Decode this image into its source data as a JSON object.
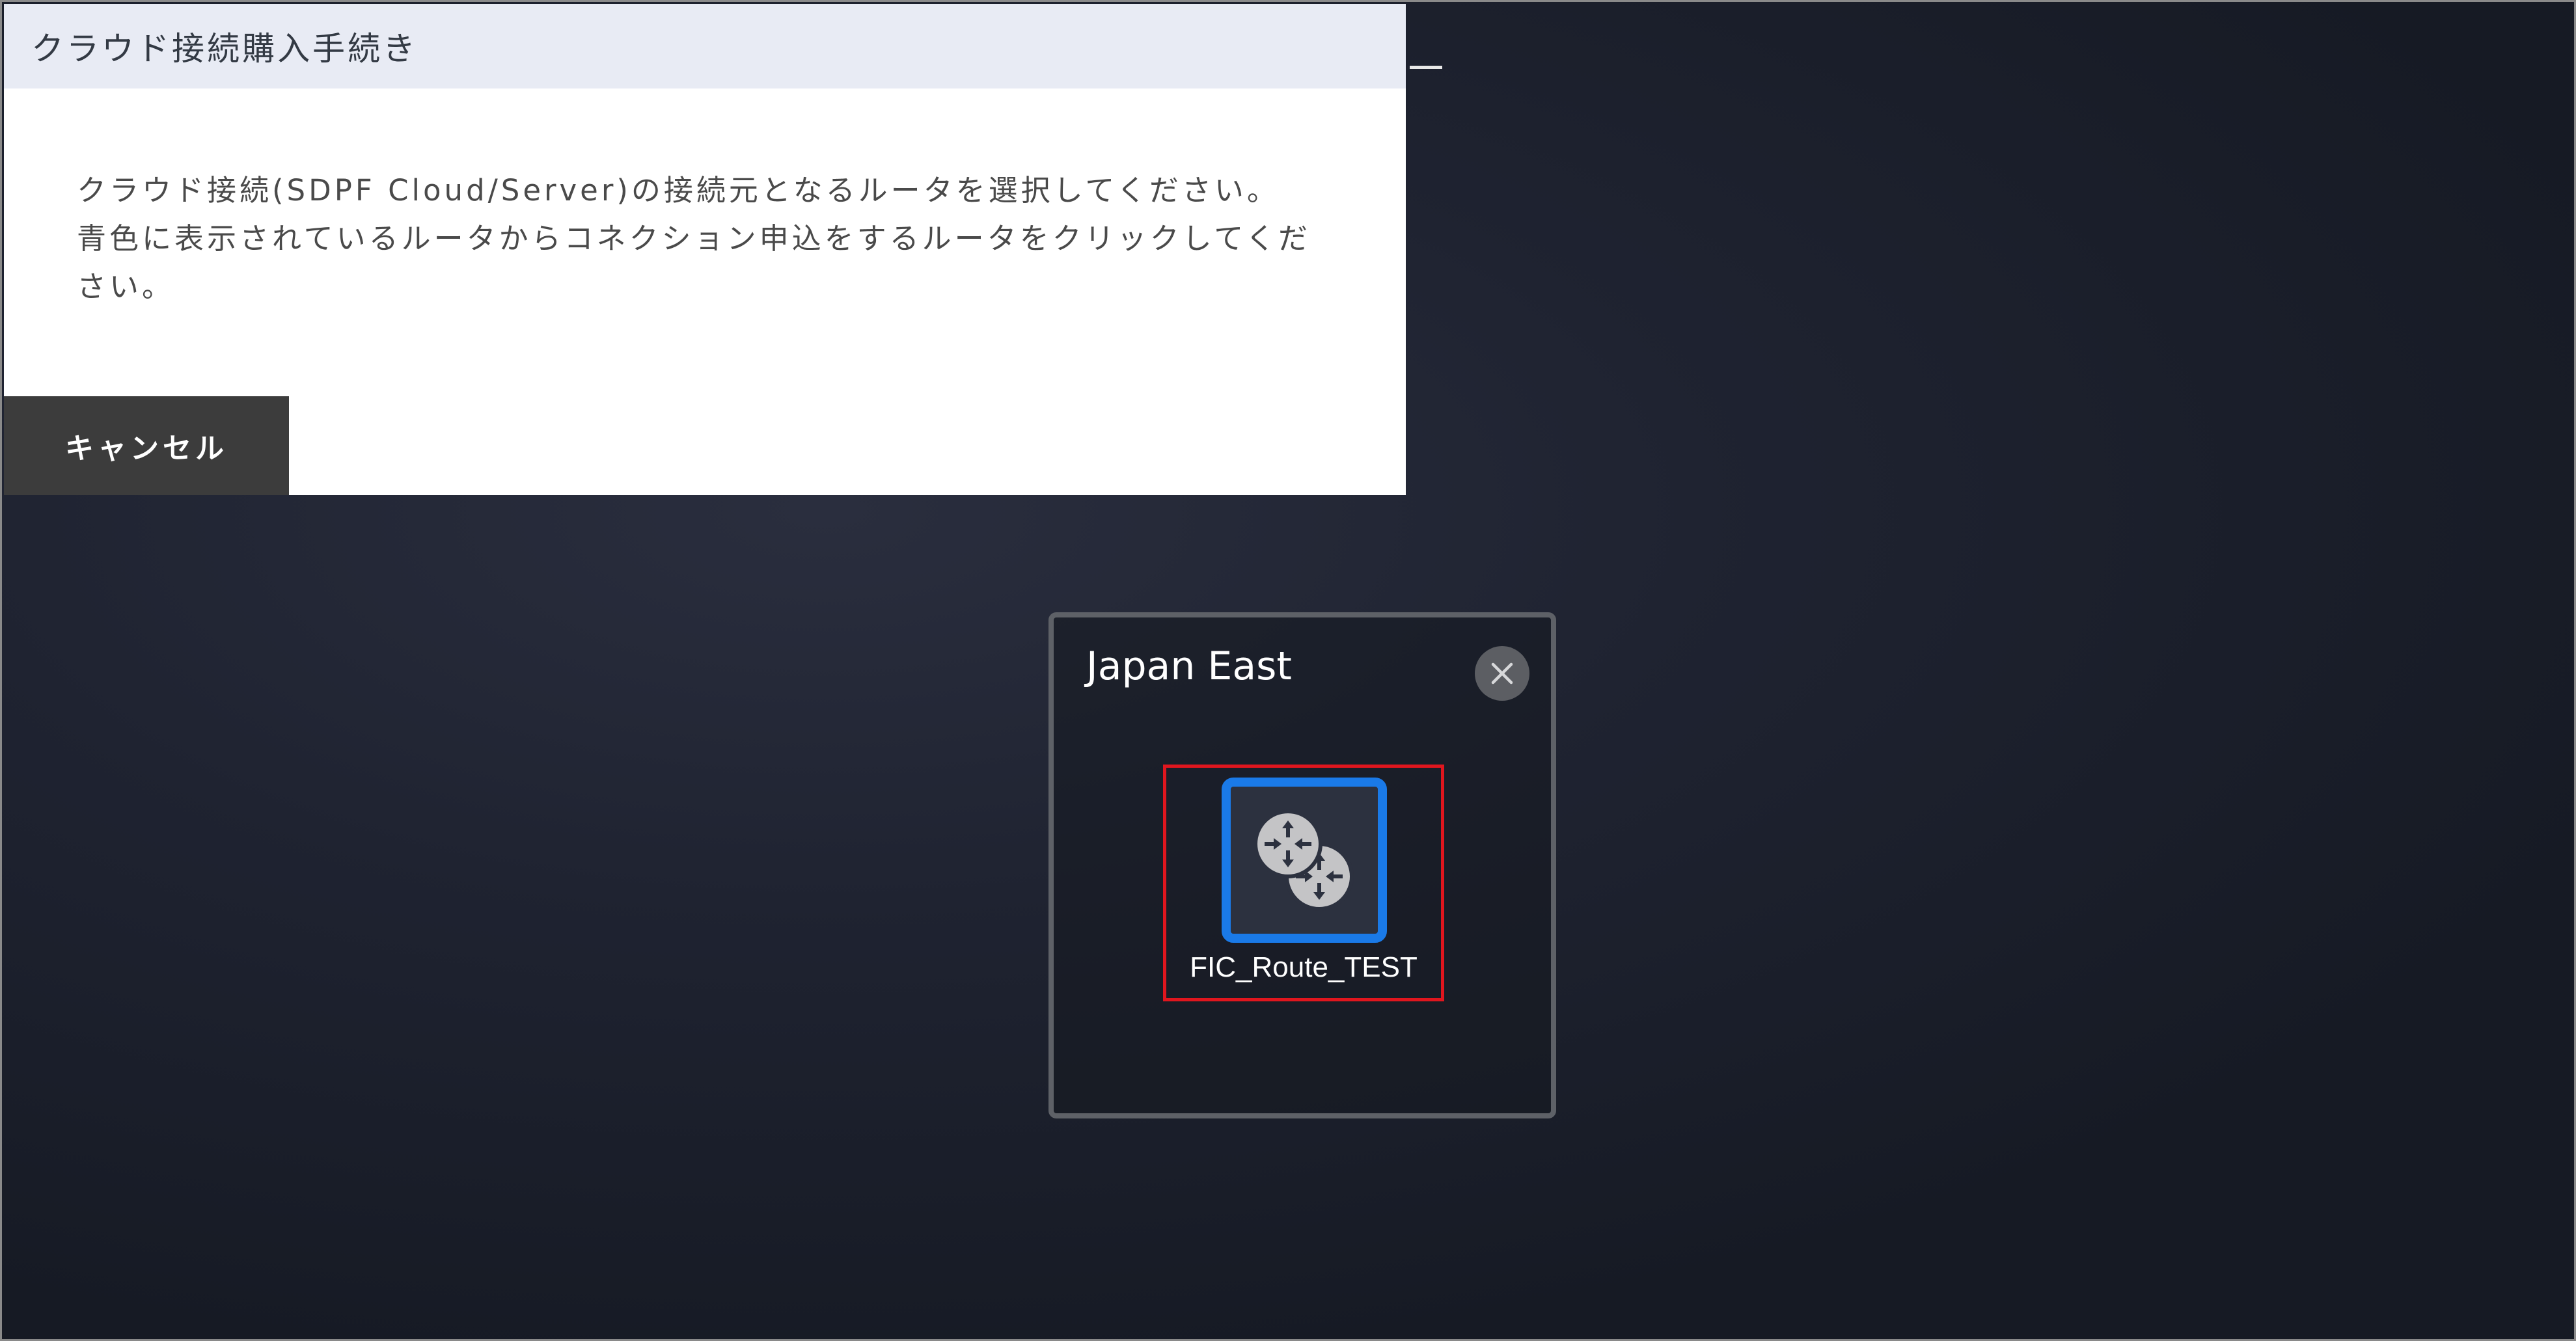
{
  "dialog": {
    "title": "クラウド接続購入手続き",
    "line1": "クラウド接続(SDPF Cloud/Server)の接続元となるルータを選択してください。",
    "line2": "青色に表示されているルータからコネクション申込をするルータをクリックしてください。",
    "cancel_label": "キャンセル"
  },
  "region": {
    "title": "Japan East",
    "router": {
      "label": "FIC_Route_TEST",
      "icon": "router-icon",
      "highlight_color": "#1a7ae8",
      "selection_color": "#e0161e"
    }
  },
  "icons": {
    "close": "close-icon",
    "minimize": "minimize-icon"
  }
}
